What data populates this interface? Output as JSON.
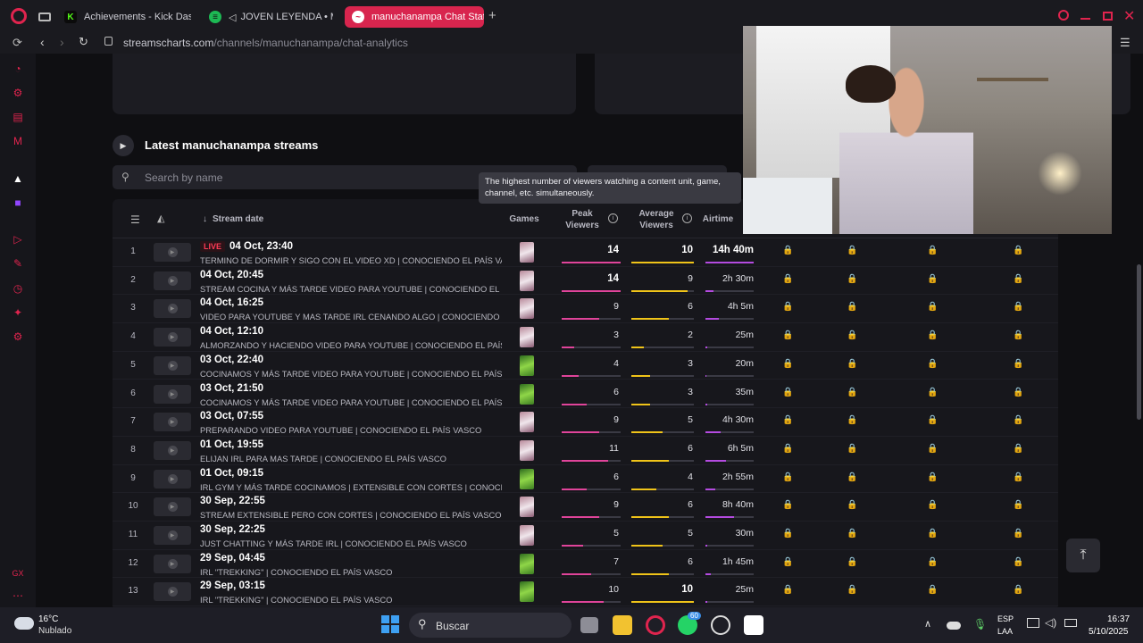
{
  "browser": {
    "tabs": [
      {
        "label": "Achievements - Kick Dash",
        "icon": "K"
      },
      {
        "label": "JOVEN LEYENDA • M",
        "icon": "spotify-icon"
      },
      {
        "label": "manuchanampa Chat Stat",
        "icon": "streamscharts-icon"
      }
    ],
    "url_host": "streamscharts.com",
    "url_path": "/channels/manuchanampa/chat-analytics"
  },
  "section": {
    "title": "Latest manuchanampa streams",
    "search_placeholder": "Search by name"
  },
  "tooltip": "The highest number of viewers watching a content unit, game, channel, etc. simultaneously.",
  "table": {
    "headers": {
      "stream_date": "Stream date",
      "games": "Games",
      "peak_viewers": "Peak Viewers",
      "average_viewers": "Average Viewers",
      "airtime": "Airtime"
    },
    "live_label": "LIVE",
    "rows": [
      {
        "n": "1",
        "date": "04 Oct, 23:40",
        "live": true,
        "title": "TERMINO DE DORMIR Y SIGO CON EL VIDEO XD | CONOCIENDO EL PAÍS VASCO",
        "game": "pink",
        "peak": "14",
        "avg": "10",
        "air": "14h 40m",
        "peak_f": 1.0,
        "avg_f": 1.0,
        "air_f": 1.0
      },
      {
        "n": "2",
        "date": "04 Oct, 20:45",
        "live": false,
        "title": "STREAM COCINA Y MÁS TARDE VIDEO PARA YOUTUBE | CONOCIENDO EL PAÍS VASCO",
        "game": "pink",
        "peak": "14",
        "avg": "9",
        "air": "2h 30m",
        "peak_f": 1.0,
        "avg_f": 0.9,
        "air_f": 0.17
      },
      {
        "n": "3",
        "date": "04 Oct, 16:25",
        "live": false,
        "title": "VIDEO PARA YOUTUBE Y MAS TARDE IRL CENANDO ALGO | CONOCIENDO EL PAÍS VASCO",
        "game": "pink",
        "peak": "9",
        "avg": "6",
        "air": "4h 5m",
        "peak_f": 0.64,
        "avg_f": 0.6,
        "air_f": 0.28
      },
      {
        "n": "4",
        "date": "04 Oct, 12:10",
        "live": false,
        "title": "ALMORZANDO Y HACIENDO VIDEO PARA YOUTUBE | CONOCIENDO EL PAÍS VASCO",
        "game": "pink",
        "peak": "3",
        "avg": "2",
        "air": "25m",
        "peak_f": 0.21,
        "avg_f": 0.2,
        "air_f": 0.03
      },
      {
        "n": "5",
        "date": "03 Oct, 22:40",
        "live": false,
        "title": "COCINAMOS Y MÁS TARDE VIDEO PARA YOUTUBE | CONOCIENDO EL PAÍS VASCO",
        "game": "green",
        "peak": "4",
        "avg": "3",
        "air": "20m",
        "peak_f": 0.29,
        "avg_f": 0.3,
        "air_f": 0.02
      },
      {
        "n": "6",
        "date": "03 Oct, 21:50",
        "live": false,
        "title": "COCINAMOS Y MÁS TARDE VIDEO PARA YOUTUBE | CONOCIENDO EL PAÍS VASCO",
        "game": "green",
        "peak": "6",
        "avg": "3",
        "air": "35m",
        "peak_f": 0.43,
        "avg_f": 0.3,
        "air_f": 0.04
      },
      {
        "n": "7",
        "date": "03 Oct, 07:55",
        "live": false,
        "title": "PREPARANDO VIDEO PARA YOUTUBE | CONOCIENDO EL PAÍS VASCO",
        "game": "pink",
        "peak": "9",
        "avg": "5",
        "air": "4h 30m",
        "peak_f": 0.64,
        "avg_f": 0.5,
        "air_f": 0.31
      },
      {
        "n": "8",
        "date": "01 Oct, 19:55",
        "live": false,
        "title": "ELIJAN IRL PARA MAS TARDE | CONOCIENDO EL PAÍS VASCO",
        "game": "pink",
        "peak": "11",
        "avg": "6",
        "air": "6h 5m",
        "peak_f": 0.79,
        "avg_f": 0.6,
        "air_f": 0.42
      },
      {
        "n": "9",
        "date": "01 Oct, 09:15",
        "live": false,
        "title": "IRL GYM Y MÁS TARDE COCINAMOS | EXTENSIBLE CON CORTES | CONOCIENDO EL PAÍS VASCO",
        "game": "green",
        "peak": "6",
        "avg": "4",
        "air": "2h 55m",
        "peak_f": 0.43,
        "avg_f": 0.4,
        "air_f": 0.2
      },
      {
        "n": "10",
        "date": "30 Sep, 22:55",
        "live": false,
        "title": "STREAM EXTENSIBLE PERO CON CORTES | CONOCIENDO EL PAÍS VASCO",
        "game": "pink",
        "peak": "9",
        "avg": "6",
        "air": "8h 40m",
        "peak_f": 0.64,
        "avg_f": 0.6,
        "air_f": 0.59
      },
      {
        "n": "11",
        "date": "30 Sep, 22:25",
        "live": false,
        "title": "JUST CHATTING Y MÁS TARDE IRL | CONOCIENDO EL PAÍS VASCO",
        "game": "pink",
        "peak": "5",
        "avg": "5",
        "air": "30m",
        "peak_f": 0.36,
        "avg_f": 0.5,
        "air_f": 0.03
      },
      {
        "n": "12",
        "date": "29 Sep, 04:45",
        "live": false,
        "title": "IRL \"TREKKING\" | CONOCIENDO EL PAÍS VASCO",
        "game": "green",
        "peak": "7",
        "avg": "6",
        "air": "1h 45m",
        "peak_f": 0.5,
        "avg_f": 0.6,
        "air_f": 0.12
      },
      {
        "n": "13",
        "date": "29 Sep, 03:15",
        "live": false,
        "title": "IRL \"TREKKING\" | CONOCIENDO EL PAÍS VASCO",
        "game": "green",
        "peak": "10",
        "avg": "10",
        "air": "25m",
        "peak_f": 0.71,
        "avg_f": 1.0,
        "air_f": 0.03
      }
    ]
  },
  "taskbar": {
    "temperature": "16°C",
    "weather": "Nublado",
    "search_label": "Buscar",
    "lang1": "ESP",
    "lang2": "LAA",
    "time": "16:37",
    "date": "5/10/2025",
    "whatsapp_badge": "60"
  },
  "colors": {
    "accent": "#d8254e",
    "peak_bar": "#e0449a",
    "avg_bar": "#f0c419",
    "air_bar": "#b44be0"
  }
}
